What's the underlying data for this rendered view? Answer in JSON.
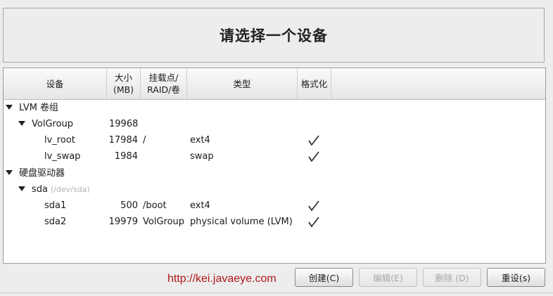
{
  "header": {
    "title": "请选择一个设备"
  },
  "table": {
    "columns": {
      "device": "设备",
      "size_line1": "大小",
      "size_line2": "(MB)",
      "mount_line1": "挂载点/",
      "mount_line2": "RAID/卷",
      "type": "类型",
      "format": "格式化"
    },
    "groups": [
      {
        "label": "LVM 卷组",
        "subgroups": [
          {
            "name": "VolGroup",
            "path": "",
            "size": "19968",
            "items": [
              {
                "name": "lv_root",
                "size": "17984",
                "mount": "/",
                "type": "ext4",
                "format": true
              },
              {
                "name": "lv_swap",
                "size": "1984",
                "mount": "",
                "type": "swap",
                "format": true
              }
            ]
          }
        ]
      },
      {
        "label": "硬盘驱动器",
        "subgroups": [
          {
            "name": "sda",
            "path": "(/dev/sda)",
            "size": "",
            "items": [
              {
                "name": "sda1",
                "size": "500",
                "mount": "/boot",
                "type": "ext4",
                "format": true
              },
              {
                "name": "sda2",
                "size": "19979",
                "mount": "VolGroup",
                "type": "physical volume (LVM)",
                "format": true
              }
            ]
          }
        ]
      }
    ]
  },
  "watermark": "http://kei.javaeye.com",
  "buttons": {
    "create": "创建(C)",
    "edit": "编辑(E)",
    "delete": "删除 (D)",
    "reset": "重设(s)"
  },
  "icons": {
    "expanded": "triangle-down-icon",
    "format": "checkmark-icon"
  },
  "colors": {
    "watermark": "#b01818",
    "disabled_text": "#a8a8a8"
  }
}
